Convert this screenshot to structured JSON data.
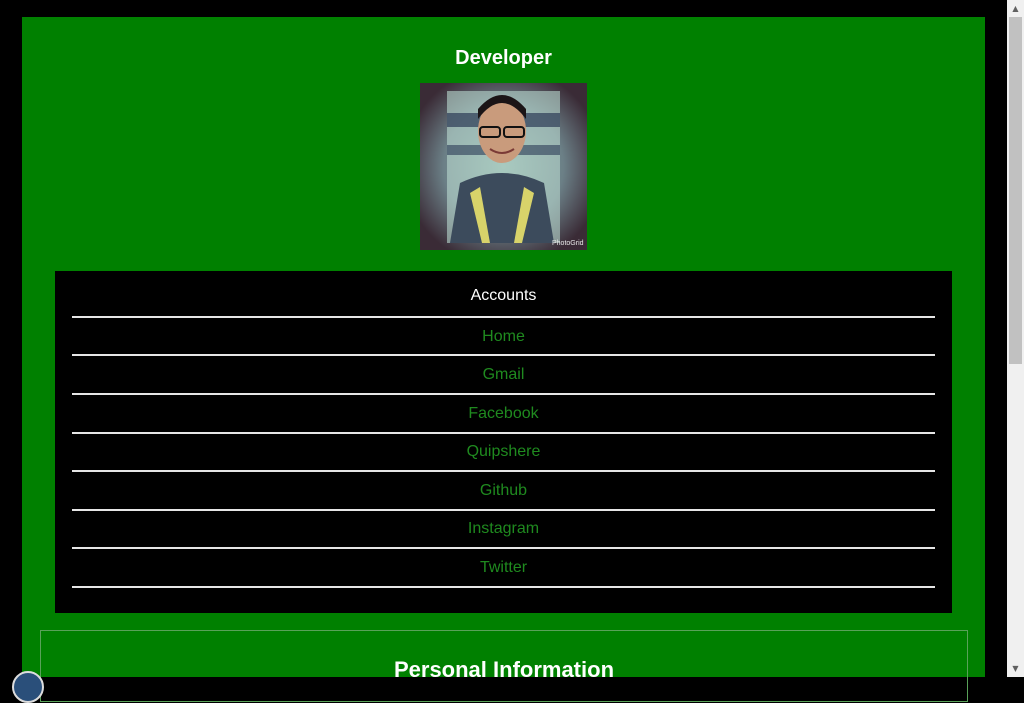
{
  "profile": {
    "title": "Developer",
    "avatar_icon": "profile-photo",
    "watermark": "PhotoGrid"
  },
  "accounts": {
    "heading": "Accounts",
    "items": [
      {
        "label": "Home"
      },
      {
        "label": "Gmail"
      },
      {
        "label": "Facebook"
      },
      {
        "label": "Quipshere"
      },
      {
        "label": "Github"
      },
      {
        "label": "Instagram"
      },
      {
        "label": "Twitter"
      }
    ]
  },
  "personal": {
    "title": "Personal Information"
  },
  "colors": {
    "page_background": "#008000",
    "outer_background": "#000000",
    "nav_background": "#000000",
    "link_color": "#1f8a1f",
    "heading_color": "#ffffff"
  }
}
